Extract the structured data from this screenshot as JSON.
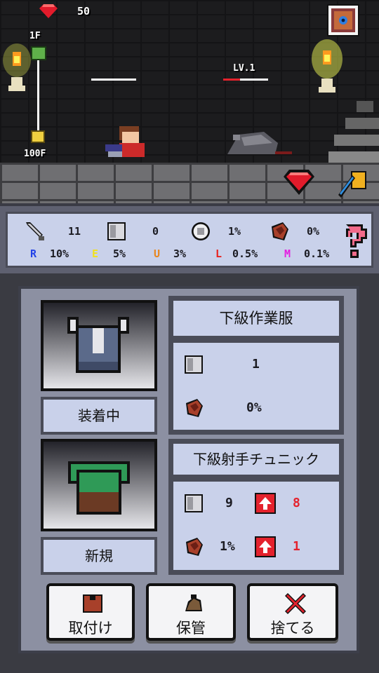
{
  "top": {
    "gems": "50"
  },
  "floors": {
    "top": "1F",
    "bottom": "100F"
  },
  "enemy": {
    "level": "LV.1"
  },
  "stats": {
    "attack": "11",
    "defense": "0",
    "crit": "1%",
    "dodge": "0%",
    "rarity": [
      {
        "letter": "R",
        "value": "10%",
        "color": "#2242e8"
      },
      {
        "letter": "E",
        "value": "5%",
        "color": "#f2e21c"
      },
      {
        "letter": "U",
        "value": "3%",
        "color": "#e8861e"
      },
      {
        "letter": "L",
        "value": "0.5%",
        "color": "#e8221e"
      },
      {
        "letter": "M",
        "value": "0.1%",
        "color": "#e41ee0"
      }
    ]
  },
  "equipped": {
    "status": "装着中",
    "name": "下級作業服",
    "defense": "1",
    "dodge": "0%"
  },
  "newitem": {
    "status": "新規",
    "name": "下級射手チュニック",
    "defense": "9",
    "defense_diff": "8",
    "dodge": "1%",
    "dodge_diff": "1"
  },
  "buttons": {
    "equip": "取付け",
    "store": "保管",
    "discard": "捨てる"
  },
  "colors": {
    "accent_red": "#e4222d",
    "panel": "#c9d1ea"
  }
}
